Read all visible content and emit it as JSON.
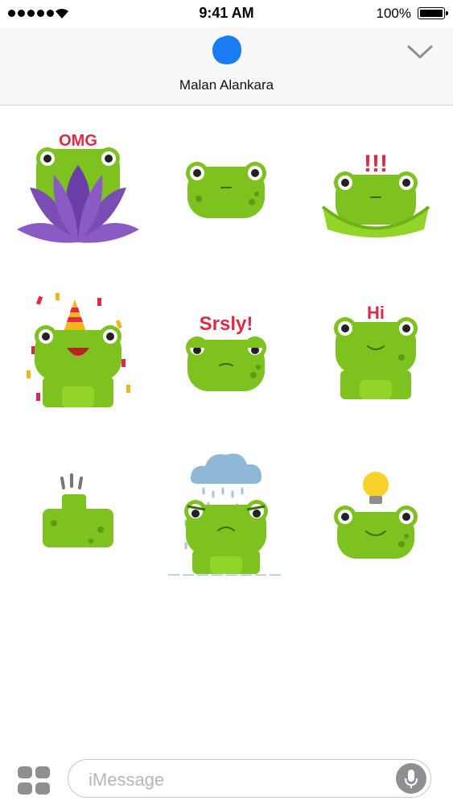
{
  "status_bar": {
    "signal_dots": 5,
    "time": "9:41 AM",
    "battery_percent": "100%",
    "battery_level": 1.0
  },
  "header": {
    "contact_name": "Malan Alankara",
    "avatar_color": "#1a7cf2",
    "collapse_icon": "chevron-down-icon"
  },
  "stickers": [
    {
      "name": "frog-omg-lotus",
      "caption": "OMG"
    },
    {
      "name": "frog-peek",
      "caption": ""
    },
    {
      "name": "frog-exclaim-leaf",
      "caption": "!!!"
    },
    {
      "name": "frog-party",
      "caption": ""
    },
    {
      "name": "frog-srsly",
      "caption": "Srsly!"
    },
    {
      "name": "frog-hi",
      "caption": "Hi"
    },
    {
      "name": "frog-thumbs-up",
      "caption": ""
    },
    {
      "name": "frog-rain-cloud",
      "caption": ""
    },
    {
      "name": "frog-idea-bulb",
      "caption": ""
    }
  ],
  "compose": {
    "placeholder": "iMessage",
    "apps_icon": "app-drawer-icon",
    "mic_icon": "microphone-icon"
  },
  "colors": {
    "frog_green": "#7dc21e",
    "frog_dark": "#5e9a14",
    "caption_red": "#e02a45",
    "lotus_purple": "#8a5bc4",
    "gray_icon": "#8e8e93"
  }
}
